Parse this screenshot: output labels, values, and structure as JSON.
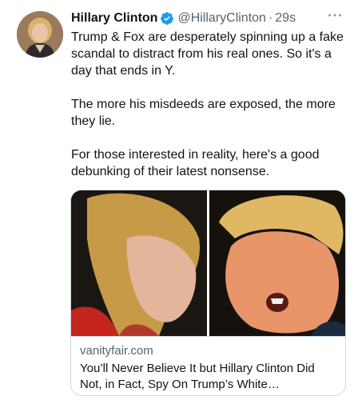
{
  "author": {
    "name": "Hillary Clinton",
    "handle": "@HillaryClinton",
    "separator": "·",
    "time": "29s",
    "verified": true
  },
  "tweet": {
    "paragraphs": [
      "Trump & Fox are desperately spinning up a fake scandal to distract from his real ones. So it's a day that ends in Y.",
      "The more his misdeeds are exposed, the more they lie.",
      "For those interested in reality, here's a good debunking of their latest nonsense."
    ]
  },
  "link_card": {
    "domain": "vanityfair.com",
    "title": "You’ll Never Believe It but Hillary Clinton Did Not, in Fact, Spy On Trump’s White…"
  },
  "icons": {
    "verified": "verified-badge-icon",
    "more": "more-options-icon"
  },
  "colors": {
    "verified": "#1d9bf0",
    "text": "#0f1419",
    "secondary": "#536471",
    "border": "#cfd9de"
  }
}
